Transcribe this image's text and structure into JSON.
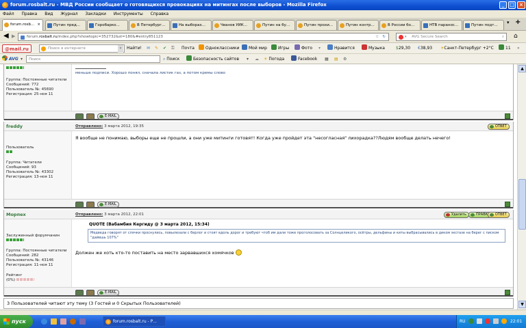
{
  "window": {
    "title": "forum.rosbalt.ru - МВД России сообщает о готовящихся провокациях на митингах после выборов - Mozilla Firefox"
  },
  "menu": [
    "Файл",
    "Правка",
    "Вид",
    "Журнал",
    "Закладки",
    "Инструменты",
    "Справка"
  ],
  "tabs": [
    {
      "label": "forum.rosb...",
      "active": true
    },
    {
      "label": "Путин пред..."
    },
    {
      "label": "Горобарко..."
    },
    {
      "label": "В Петербург..."
    },
    {
      "label": "На выборах..."
    },
    {
      "label": "Чванов УИК..."
    },
    {
      "label": "Путин на бу..."
    },
    {
      "label": "Путин прохи..."
    },
    {
      "label": "Путин контр..."
    },
    {
      "label": "В России бо..."
    },
    {
      "label": "НТВ паранос..."
    },
    {
      "label": "Путин подт..."
    }
  ],
  "nav": {
    "url_prefix": "forum.",
    "url_domain": "rosbalt.ru",
    "url_rest": "/index.php?showtopic=352732&st=180&#entry851123",
    "search_placeholder": "AVG Secure Search",
    "new_tab": "+"
  },
  "toolbar1": {
    "logo": "@mail.ru",
    "search_placeholder": "Поиск в интернете",
    "find": "Найти!",
    "items": [
      "Почта",
      "Одноклассники",
      "Мой мир",
      "Игры",
      "Фото",
      "Нравится",
      "Музыка"
    ],
    "rate1": "29,30",
    "rate2": "38,93",
    "weather": "Санкт-Петербург +2°C",
    "count": "11"
  },
  "toolbar2": {
    "logo": "AVG",
    "search_placeholder": "Поиск",
    "items": [
      "Поиск",
      "Безопасность сайтов",
      "Погода",
      "Facebook"
    ]
  },
  "posts": [
    {
      "sidebar_lines": [
        "Группа: Постоянные читатели",
        "Сообщений: 772",
        "Пользователь №: 45690",
        "Регистрация: 25-ноя 11"
      ],
      "body": "меньше подписи. Хорошо понял, сначала листик газ, а потом кремы слово",
      "footer_pills": [
        "E-MAIL"
      ]
    },
    {
      "author": "freddy",
      "meta_label": "Отправлено:",
      "meta_date": "3 марта 2012, 19:35",
      "sidebar_role": "Пользователь",
      "sidebar_lines": [
        "Группа: Читатели",
        "Сообщений: 93",
        "Пользователь №: 43302",
        "Регистрация: 13-ноя 11"
      ],
      "body": "Я вообще не понимаю, выборы еще не прошли, а они уже митинги готовят! Когда уже пройдет эта \"несогласная\" лихорадка??Людям вообще делать нечего!",
      "header_pills": [
        "ОТВЕТ"
      ],
      "footer_pills": [
        "E-MAIL"
      ]
    },
    {
      "author": "Морпех",
      "meta_label": "Отправлено:",
      "meta_date": "3 марта 2012, 22:01",
      "sidebar_role": "Заслуженный форумчанин",
      "sidebar_lines": [
        "Группа: Постоянные читатели",
        "Сообщений: 282",
        "Пользователь №: 43146",
        "Регистрация: 11-ноя 11"
      ],
      "sidebar_rating_label": "Рейтинг",
      "sidebar_rating_value": "(0%)",
      "quote_title": "QUOTE (Вабамбия Кергиду @ 3 марта 2012, 15:34)",
      "quote_text": "Медведа говорят от спячки проснулись, повылезали с берлог и стоят вдоль дорог и требуют чтоб им дали тоже проголосовать за Солнцеликого, осётры, дельфины и киты выбрасывались в диком экстазе на берег с писком \"дайешь 107%\"",
      "body": "Должен же хоть кто-то поставить на место зарвавшихся хомячков",
      "header_pills": [
        "Удалить",
        "ПРАВКА",
        "ОТВЕТ"
      ],
      "footer_pills": [
        "E-MAIL"
      ]
    }
  ],
  "readers_info": "3 Пользователей читают эту тему (3 Гостей и 0 Скрытых Пользователей)",
  "taskbar": {
    "start": "пуск",
    "task": "forum.rosbalt.ru - Р...",
    "lang": "RU",
    "time": "22:01"
  }
}
